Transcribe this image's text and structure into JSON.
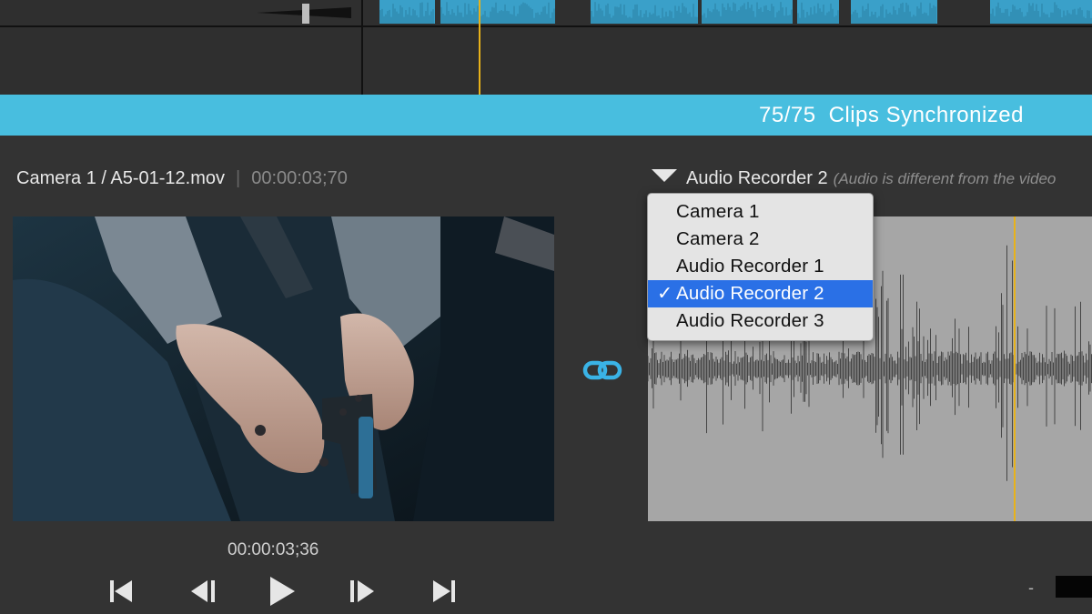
{
  "sync_banner": {
    "count": "75/75",
    "status": "Clips Synchronized"
  },
  "video_pane": {
    "source": "Camera 1 / A5-01-12.mov",
    "separator": "|",
    "source_timecode": "00:00:03;70",
    "playback_timecode": "00:00:03;36"
  },
  "audio_pane": {
    "selected_source": "Audio Recorder 2",
    "note": "(Audio is different from the video"
  },
  "source_menu": {
    "check_glyph": "✓",
    "items": [
      {
        "label": "Camera 1",
        "selected": false
      },
      {
        "label": "Camera 2",
        "selected": false
      },
      {
        "label": "Audio Recorder 1",
        "selected": false
      },
      {
        "label": "Audio Recorder 2",
        "selected": true
      },
      {
        "label": "Audio Recorder 3",
        "selected": false
      }
    ]
  },
  "zoom": {
    "minus_label": "-"
  },
  "icons": {
    "link": "link-icon",
    "skip_start": "skip-to-start-icon",
    "step_back": "step-back-icon",
    "play": "play-icon",
    "step_forward": "step-forward-icon",
    "skip_end": "skip-to-end-icon",
    "dropdown": "dropdown-triangle-icon",
    "volume": "volume-wedge-icon"
  },
  "colors": {
    "banner": "#48bedf",
    "clip": "#3aa0c9",
    "accent_link": "#3ab3e6",
    "playhead": "#e8b21a",
    "menu_selection": "#2a70e6"
  }
}
